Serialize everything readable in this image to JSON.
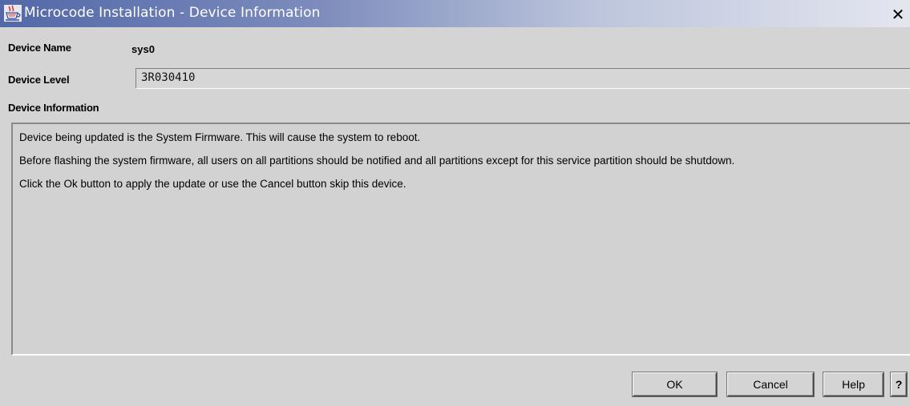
{
  "window": {
    "title": "Microcode Installation - Device Information",
    "close_glyph": "✕",
    "icon": "java-cup-icon"
  },
  "fields": {
    "device_name_label": "Device Name",
    "device_name_value": "sys0",
    "device_level_label": "Device Level",
    "device_level_value": "3R030410",
    "device_information_label": "Device Information"
  },
  "info": {
    "paragraphs": [
      "Device being updated is the System Firmware.  This will cause the system to reboot.",
      "Before flashing the system firmware, all users on all partitions should be notified and all partitions except for this service partition should be shutdown.",
      "Click the Ok button to apply the update or use the Cancel button skip this device."
    ]
  },
  "buttons": {
    "ok": "OK",
    "cancel": "Cancel",
    "help": "Help",
    "context_help": "?"
  },
  "colors": {
    "window_bg": "#d4d4d4",
    "titlebar_start": "#5268a8",
    "titlebar_end": "#e4e6ef"
  }
}
